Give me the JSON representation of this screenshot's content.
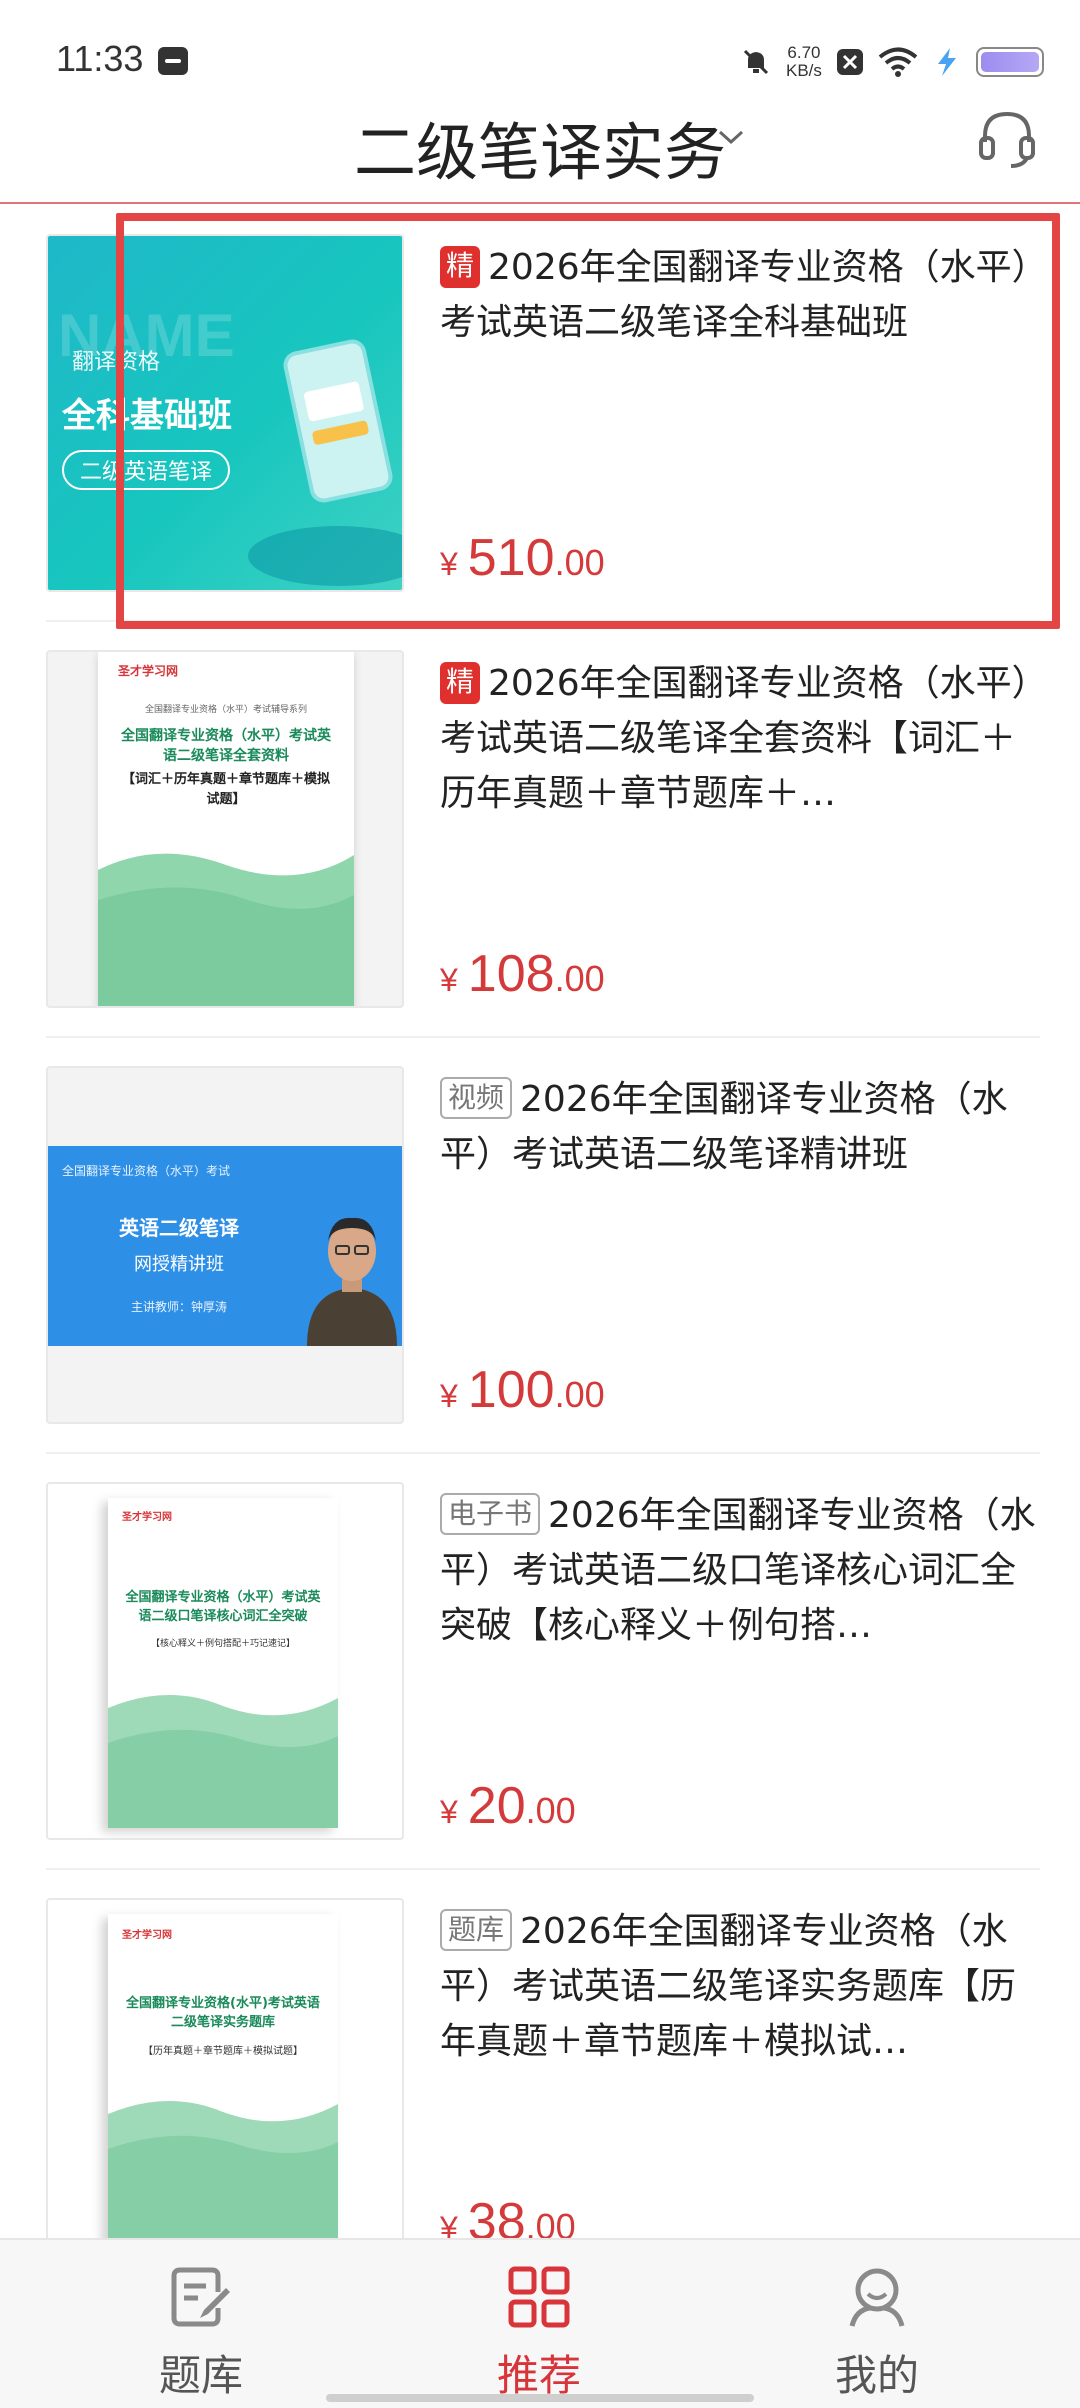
{
  "status_bar": {
    "time": "11:33",
    "net_speed_value": "6.70",
    "net_speed_unit": "KB/s",
    "icons": [
      "message-icon",
      "mute-icon",
      "close-box-icon",
      "wifi-icon",
      "charging-icon",
      "battery-icon"
    ]
  },
  "header": {
    "title": "二级笔译实务",
    "icons": [
      "chevron-down-icon",
      "headset-icon"
    ]
  },
  "products": [
    {
      "badge": "精",
      "badge_style": "solid",
      "title": "2026年全国翻译专业资格（水平）考试英语二级笔译全科基础班",
      "currency": "¥",
      "price_int": "510",
      "price_dec": ".00",
      "thumb": {
        "tag": "翻译资格",
        "heading": "全科基础班",
        "pill": "二级英语笔译"
      }
    },
    {
      "badge": "精",
      "badge_style": "solid",
      "title": "2026年全国翻译专业资格（水平）考试英语二级笔译全套资料【词汇＋历年真题＋章节题库＋…",
      "currency": "¥",
      "price_int": "108",
      "price_dec": ".00",
      "thumb": {
        "brand": "圣才学习网",
        "series": "全国翻译专业资格（水平）考试辅导系列",
        "heading": "全国翻译专业资格（水平）考试英语二级笔译全套资料",
        "sub": "【词汇＋历年真题＋章节题库＋模拟试题】"
      }
    },
    {
      "badge": "视频",
      "badge_style": "outline",
      "title": "2026年全国翻译专业资格（水平）考试英语二级笔译精讲班",
      "currency": "¥",
      "price_int": "100",
      "price_dec": ".00",
      "thumb": {
        "top": "全国翻译专业资格（水平）考试",
        "heading": "英语二级笔译",
        "sub": "网授精讲班",
        "teacher": "主讲教师：钟厚涛"
      }
    },
    {
      "badge": "电子书",
      "badge_style": "outline",
      "title": "2026年全国翻译专业资格（水平）考试英语二级口笔译核心词汇全突破【核心释义＋例句搭…",
      "currency": "¥",
      "price_int": "20",
      "price_dec": ".00",
      "thumb": {
        "brand": "圣才学习网",
        "heading": "全国翻译专业资格（水平）考试英语二级口笔译核心词汇全突破",
        "sub": "【核心释义＋例句搭配＋巧记速记】"
      }
    },
    {
      "badge": "题库",
      "badge_style": "outline",
      "title": "2026年全国翻译专业资格（水平）考试英语二级笔译实务题库【历年真题＋章节题库＋模拟试…",
      "currency": "¥",
      "price_int": "38",
      "price_dec": ".00",
      "thumb": {
        "brand": "圣才学习网",
        "heading": "全国翻译专业资格(水平)考试英语二级笔译实务题库",
        "sub": "【历年真题＋章节题库＋模拟试题】"
      }
    }
  ],
  "bottom_nav": {
    "items": [
      {
        "label": "题库",
        "icon": "question-bank-icon",
        "active": false
      },
      {
        "label": "推荐",
        "icon": "grid-icon",
        "active": true
      },
      {
        "label": "我的",
        "icon": "profile-icon",
        "active": false
      }
    ]
  },
  "colors": {
    "accent": "#d8353a",
    "price": "#d43a3a",
    "highlight": "#e34444"
  }
}
